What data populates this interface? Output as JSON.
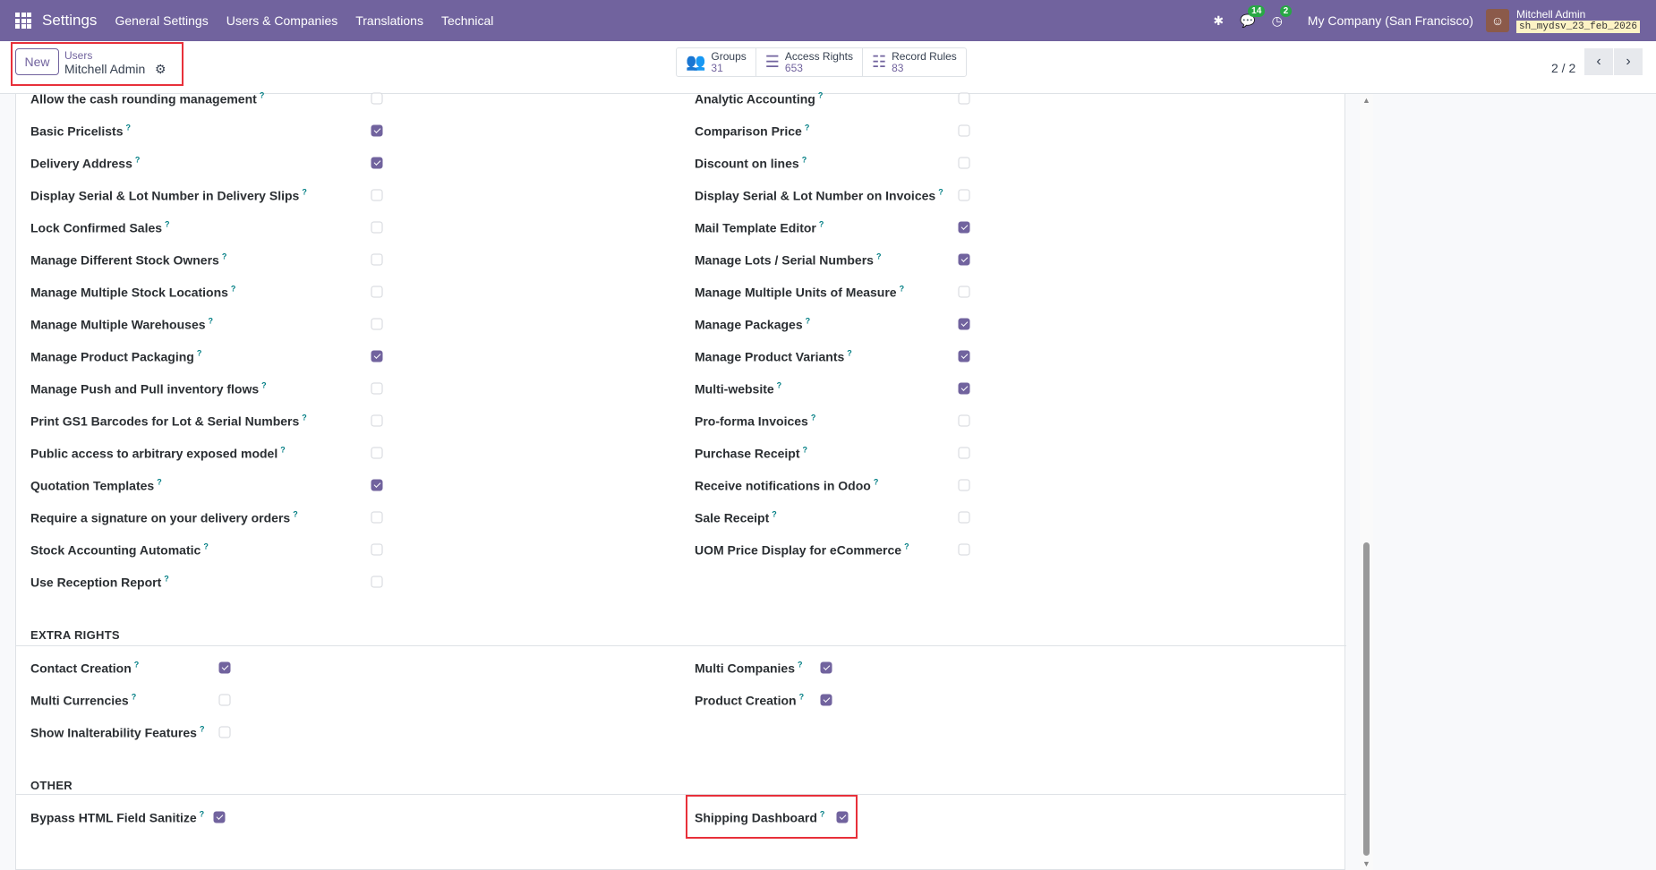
{
  "topbar": {
    "app": "Settings",
    "menus": [
      "General Settings",
      "Users & Companies",
      "Translations",
      "Technical"
    ],
    "messages_count": "14",
    "activities_count": "2",
    "company": "My Company (San Francisco)",
    "user": "Mitchell Admin",
    "database": "sh_mydsv_23_feb_2026"
  },
  "control": {
    "new_label": "New",
    "breadcrumb_parent": "Users",
    "breadcrumb_current": "Mitchell Admin",
    "stats": [
      {
        "label": "Groups",
        "value": "31"
      },
      {
        "label": "Access Rights",
        "value": "653"
      },
      {
        "label": "Record Rules",
        "value": "83"
      }
    ],
    "pager": "2 / 2"
  },
  "left_items": [
    {
      "label": "Allow the cash rounding management",
      "checked": false
    },
    {
      "label": "Basic Pricelists",
      "checked": true
    },
    {
      "label": "Delivery Address",
      "checked": true
    },
    {
      "label": "Display Serial & Lot Number in Delivery Slips",
      "checked": false
    },
    {
      "label": "Lock Confirmed Sales",
      "checked": false
    },
    {
      "label": "Manage Different Stock Owners",
      "checked": false
    },
    {
      "label": "Manage Multiple Stock Locations",
      "checked": false
    },
    {
      "label": "Manage Multiple Warehouses",
      "checked": false
    },
    {
      "label": "Manage Product Packaging",
      "checked": true
    },
    {
      "label": "Manage Push and Pull inventory flows",
      "checked": false
    },
    {
      "label": "Print GS1 Barcodes for Lot & Serial Numbers",
      "checked": false
    },
    {
      "label": "Public access to arbitrary exposed model",
      "checked": false
    },
    {
      "label": "Quotation Templates",
      "checked": true
    },
    {
      "label": "Require a signature on your delivery orders",
      "checked": false
    },
    {
      "label": "Stock Accounting Automatic",
      "checked": false
    },
    {
      "label": "Use Reception Report",
      "checked": false
    }
  ],
  "right_items": [
    {
      "label": "Analytic Accounting",
      "checked": false
    },
    {
      "label": "Comparison Price",
      "checked": false
    },
    {
      "label": "Discount on lines",
      "checked": false
    },
    {
      "label": "Display Serial & Lot Number on Invoices",
      "checked": false
    },
    {
      "label": "Mail Template Editor",
      "checked": true
    },
    {
      "label": "Manage Lots / Serial Numbers",
      "checked": true
    },
    {
      "label": "Manage Multiple Units of Measure",
      "checked": false
    },
    {
      "label": "Manage Packages",
      "checked": true
    },
    {
      "label": "Manage Product Variants",
      "checked": true
    },
    {
      "label": "Multi-website",
      "checked": true
    },
    {
      "label": "Pro-forma Invoices",
      "checked": false
    },
    {
      "label": "Purchase Receipt",
      "checked": false
    },
    {
      "label": "Receive notifications in Odoo",
      "checked": false
    },
    {
      "label": "Sale Receipt",
      "checked": false
    },
    {
      "label": "UOM Price Display for eCommerce",
      "checked": false
    }
  ],
  "extra_rights": {
    "title": "EXTRA RIGHTS",
    "left": [
      {
        "label": "Contact Creation",
        "checked": true
      },
      {
        "label": "Multi Currencies",
        "checked": false
      },
      {
        "label": "Show Inalterability Features",
        "checked": false
      }
    ],
    "right": [
      {
        "label": "Multi Companies",
        "checked": true
      },
      {
        "label": "Product Creation",
        "checked": true
      }
    ]
  },
  "other": {
    "title": "OTHER",
    "left": [
      {
        "label": "Bypass HTML Field Sanitize",
        "checked": true
      }
    ],
    "right": [
      {
        "label": "Shipping Dashboard",
        "checked": true
      }
    ]
  },
  "help_mark": "?",
  "colors": {
    "brand": "#71639e",
    "highlight": "#e8303a"
  }
}
